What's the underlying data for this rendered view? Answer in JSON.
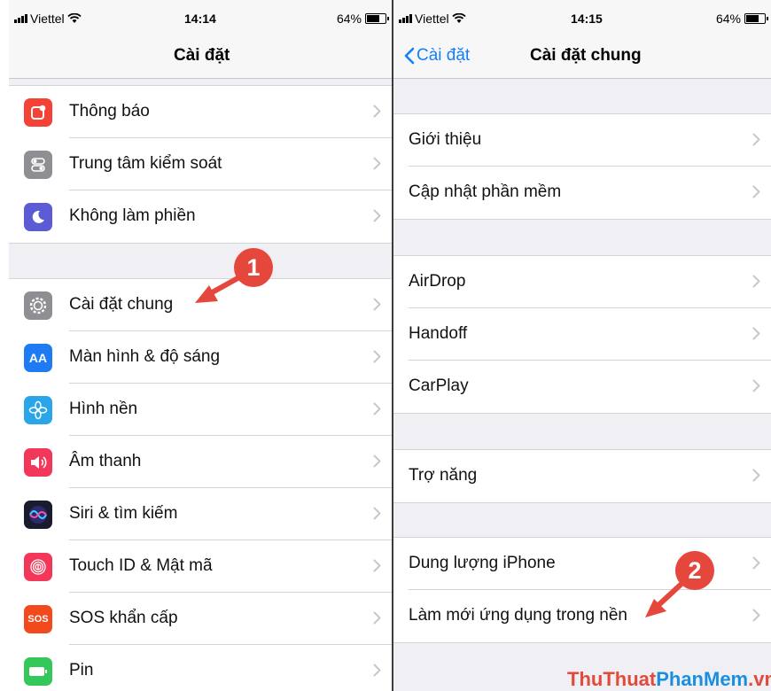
{
  "left": {
    "status": {
      "carrier": "Viettel",
      "time": "14:14",
      "battery": "64%"
    },
    "title": "Cài đặt",
    "groups": [
      [
        {
          "label": "Thông báo",
          "icon": "notifications-icon",
          "color": "#f44336"
        },
        {
          "label": "Trung tâm kiểm soát",
          "icon": "control-center-icon",
          "color": "#8e8e93"
        },
        {
          "label": "Không làm phiền",
          "icon": "moon-icon",
          "color": "#5b5bd6"
        }
      ],
      [
        {
          "label": "Cài đặt chung",
          "icon": "gear-icon",
          "color": "#8e8e93"
        },
        {
          "label": "Màn hình & độ sáng",
          "icon": "display-brightness-icon",
          "color": "#1e7bf2",
          "icon_text": "AA"
        },
        {
          "label": "Hình nền",
          "icon": "wallpaper-icon",
          "color": "#2aa6e8"
        },
        {
          "label": "Âm thanh",
          "icon": "sound-icon",
          "color": "#f2375a"
        },
        {
          "label": "Siri & tìm kiếm",
          "icon": "siri-icon",
          "color": "#1b1b2e"
        },
        {
          "label": "Touch ID & Mật mã",
          "icon": "fingerprint-icon",
          "color": "#f2375a"
        },
        {
          "label": "SOS khẩn cấp",
          "icon": "sos-icon",
          "color": "#f24a1e",
          "icon_text": "SOS"
        },
        {
          "label": "Pin",
          "icon": "battery-icon",
          "color": "#34c759"
        }
      ]
    ]
  },
  "right": {
    "status": {
      "carrier": "Viettel",
      "time": "14:15",
      "battery": "64%"
    },
    "back_label": "Cài đặt",
    "title": "Cài đặt chung",
    "groups": [
      [
        "Giới thiệu",
        "Cập nhật phần mềm"
      ],
      [
        "AirDrop",
        "Handoff",
        "CarPlay"
      ],
      [
        "Trợ năng"
      ],
      [
        "Dung lượng iPhone",
        "Làm mới ứng dụng trong nền"
      ]
    ]
  },
  "annotations": [
    "1",
    "2"
  ],
  "watermark": {
    "part1": "ThuThuat",
    "part2": "PhanMem",
    "part3": ".vn"
  },
  "colors": {
    "accent": "#157efb",
    "annotation": "#e5473c"
  }
}
